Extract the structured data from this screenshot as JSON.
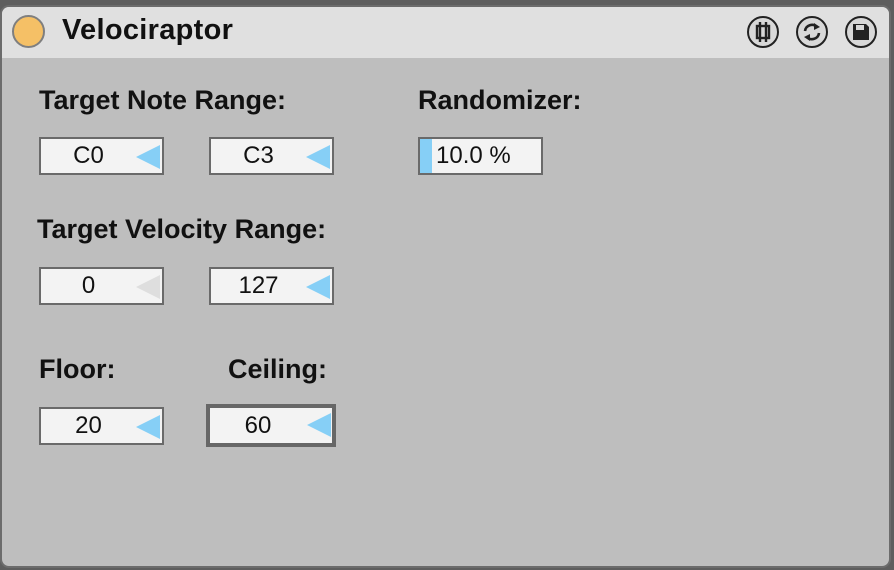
{
  "device": {
    "title": "Velociraptor",
    "power_color": "#f5c066",
    "header_icons": [
      "freeze-icon",
      "hot-swap-icon",
      "save-preset-icon"
    ]
  },
  "note_range": {
    "label": "Target Note Range:",
    "low": "C0",
    "high": "C3"
  },
  "randomizer": {
    "label": "Randomizer:",
    "value": "10.0 %",
    "fraction": 0.1
  },
  "velocity_range": {
    "label": "Target Velocity Range:",
    "low": "0",
    "high": "127"
  },
  "floor": {
    "label": "Floor:",
    "value": "20"
  },
  "ceiling": {
    "label": "Ceiling:",
    "value": "60"
  },
  "colors": {
    "accent": "#86cff6",
    "panel": "#bebebe",
    "header": "#e0e0e0"
  }
}
